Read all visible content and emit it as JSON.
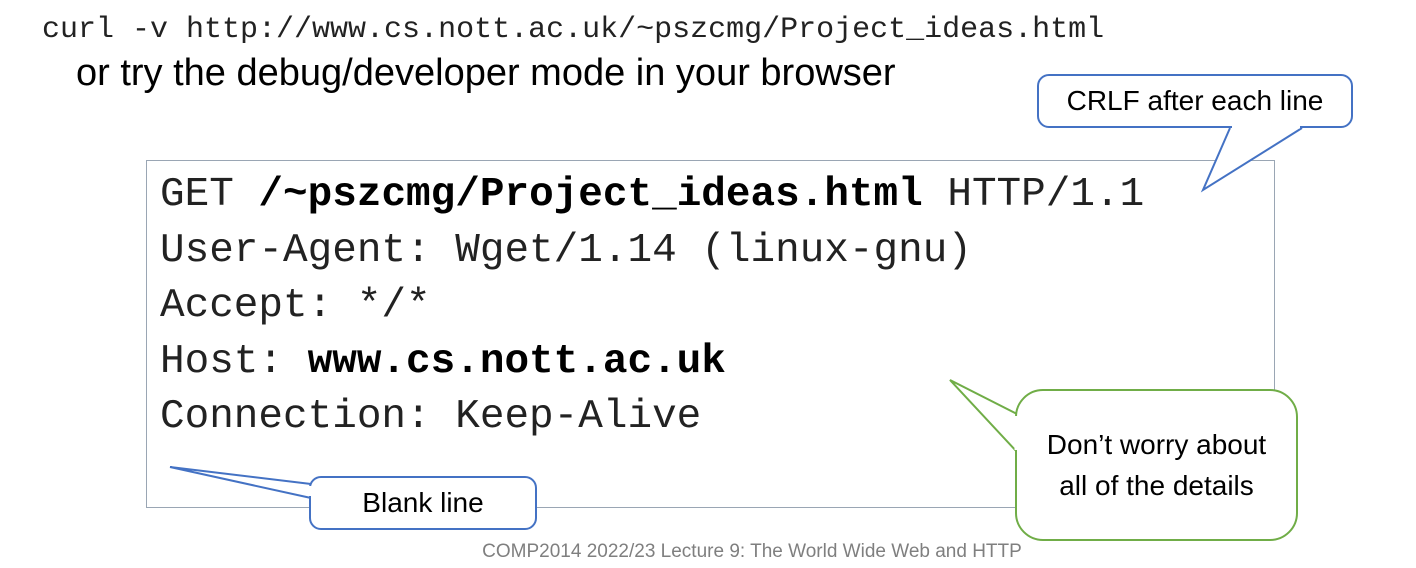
{
  "command": "curl -v http://www.cs.nott.ac.uk/~pszcmg/Project_ideas.html",
  "subtitle": "or try the debug/developer mode in your browser",
  "request": {
    "line1": {
      "method": "GET ",
      "path": "/~pszcmg/Project_ideas.html",
      "version": " HTTP/1.1"
    },
    "line2": "User-Agent: Wget/1.14 (linux-gnu)",
    "line3": "Accept: */*",
    "line4": {
      "key": "Host: ",
      "value": "www.cs.nott.ac.uk"
    },
    "line5": "Connection: Keep-Alive"
  },
  "callouts": {
    "crlf": "CRLF after each line",
    "blank": "Blank line",
    "worry": "Don’t worry about all of the details"
  },
  "footer": "COMP2014 2022/23 Lecture 9: The World Wide Web and HTTP",
  "colors": {
    "blue_callout": "#4472c4",
    "green_callout": "#70ad47",
    "box_border": "#9aa6b4",
    "footer_text": "#7f7f7f"
  }
}
